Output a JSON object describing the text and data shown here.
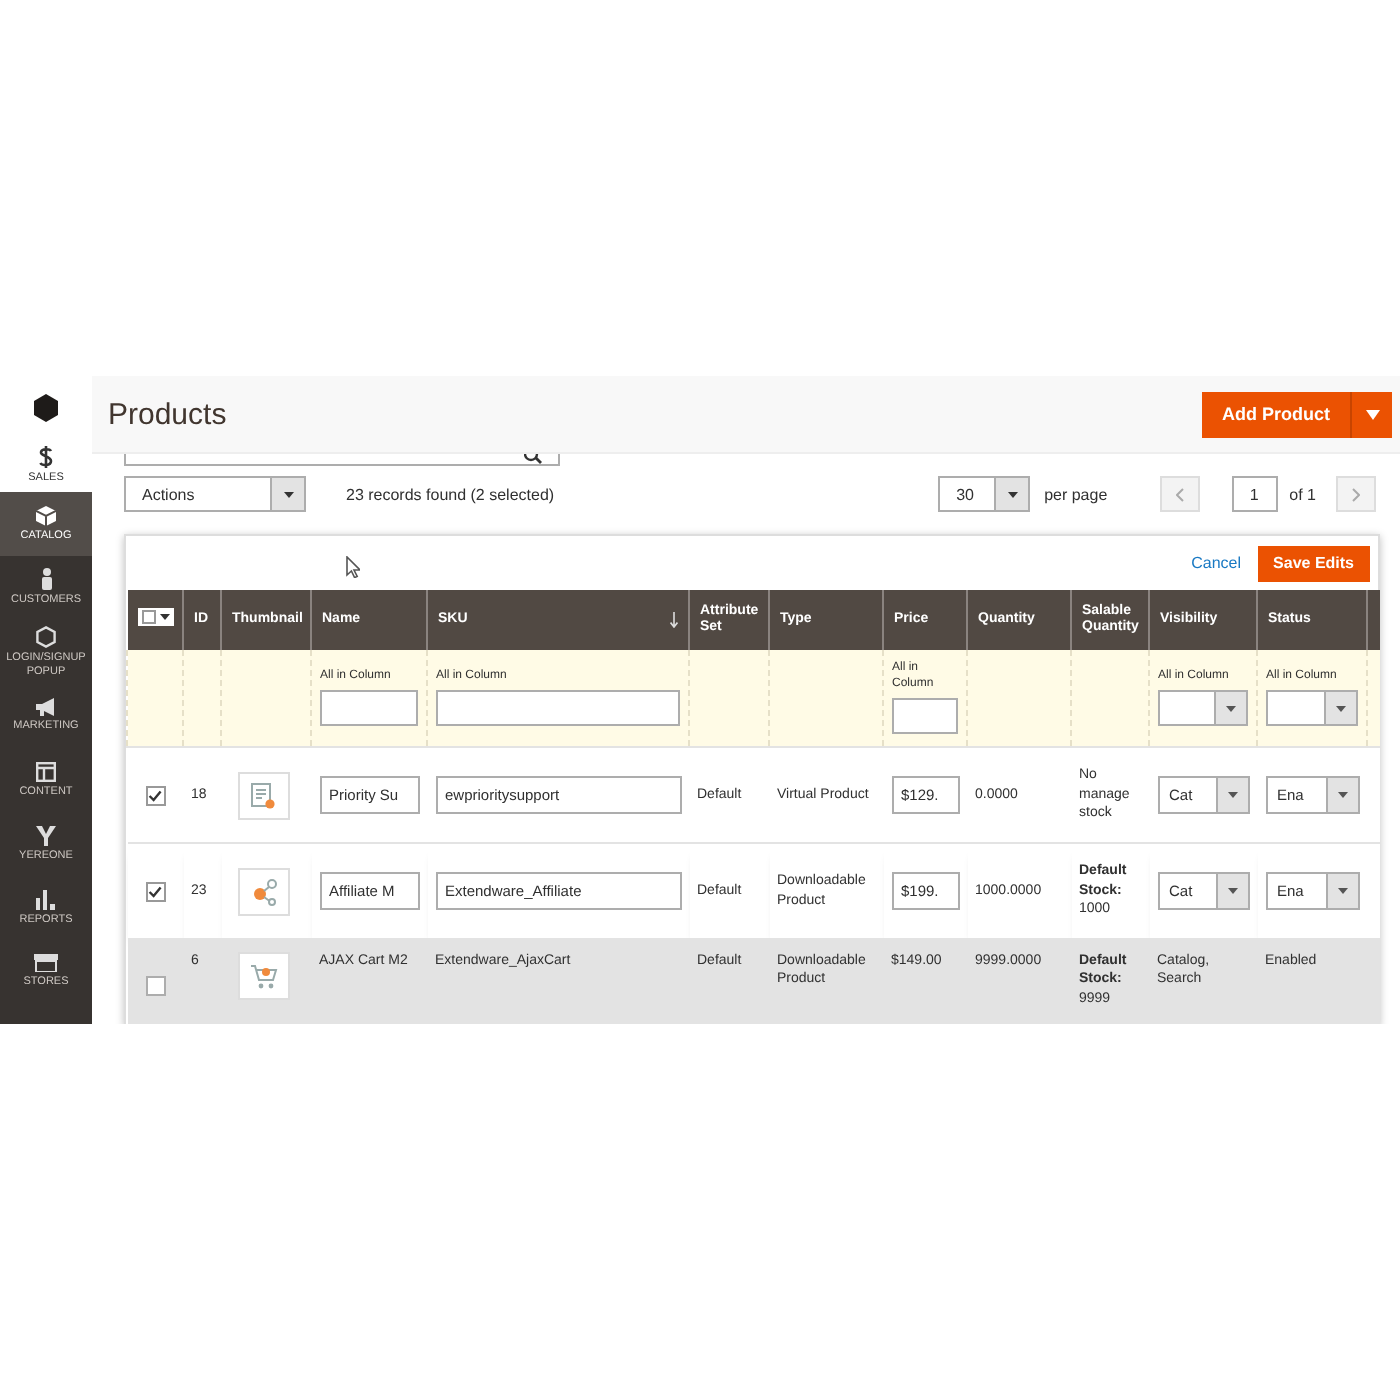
{
  "sidebar": {
    "items": [
      {
        "label": "SALES",
        "selected": false
      },
      {
        "label": "CATALOG",
        "selected": true
      },
      {
        "label": "CUSTOMERS",
        "selected": false
      },
      {
        "label": "LOGIN/SIGNUP POPUP",
        "selected": false
      },
      {
        "label": "MARKETING",
        "selected": false
      },
      {
        "label": "CONTENT",
        "selected": false
      },
      {
        "label": "YEREONE",
        "selected": false
      },
      {
        "label": "REPORTS",
        "selected": false
      },
      {
        "label": "STORES",
        "selected": false
      }
    ]
  },
  "page": {
    "title": "Products",
    "primary_button": "Add Product"
  },
  "toolbar": {
    "actions": "Actions",
    "records": "23 records found (2 selected)",
    "per_page_value": "30",
    "per_page_label": "per page",
    "page_value": "1",
    "page_of": "of 1"
  },
  "edit_bar": {
    "cancel": "Cancel",
    "save": "Save Edits"
  },
  "table": {
    "columns": [
      {
        "kind": "select_all"
      },
      {
        "label": "ID"
      },
      {
        "label": "Thumbnail"
      },
      {
        "label": "Name",
        "filter": {
          "kind": "text",
          "label": "All in Column"
        }
      },
      {
        "label": "SKU",
        "sorted": true,
        "filter": {
          "kind": "text",
          "label": "All in Column"
        }
      },
      {
        "label": "Attribute Set"
      },
      {
        "label": "Type"
      },
      {
        "label": "Price",
        "filter": {
          "kind": "text",
          "label": "All in Column"
        }
      },
      {
        "label": "Quantity"
      },
      {
        "label": "Salable Quantity"
      },
      {
        "label": "Visibility",
        "filter": {
          "kind": "select",
          "label": "All in Column"
        }
      },
      {
        "label": "Status",
        "filter": {
          "kind": "select",
          "label": "All in Column"
        }
      }
    ],
    "rows": [
      {
        "kind": "edit",
        "selected": true,
        "id": "18",
        "name": "Priority Su",
        "sku": "ewprioritysupport",
        "attribute_set": "Default",
        "type": "Virtual Product",
        "price": "$129.",
        "quantity": "0.0000",
        "salable": "No manage stock",
        "visibility": "Cat",
        "status": "Ena"
      },
      {
        "kind": "edit",
        "selected": true,
        "id": "23",
        "name": "Affiliate M",
        "sku": "Extendware_Affiliate",
        "attribute_set": "Default",
        "type": "Downloadable Product",
        "price": "$199.",
        "quantity": "1000.0000",
        "salable": "**Default Stock:** 1000",
        "visibility": "Cat",
        "status": "Ena"
      },
      {
        "kind": "view",
        "selected": false,
        "id": "6",
        "name": "AJAX Cart M2",
        "sku": "Extendware_AjaxCart",
        "attribute_set": "Default",
        "type": "Downloadable Product",
        "price": "$149.00",
        "quantity": "9999.0000",
        "salable": "**Default Stock:** 9999",
        "visibility": "Catalog, Search",
        "status": "Enabled"
      }
    ]
  }
}
